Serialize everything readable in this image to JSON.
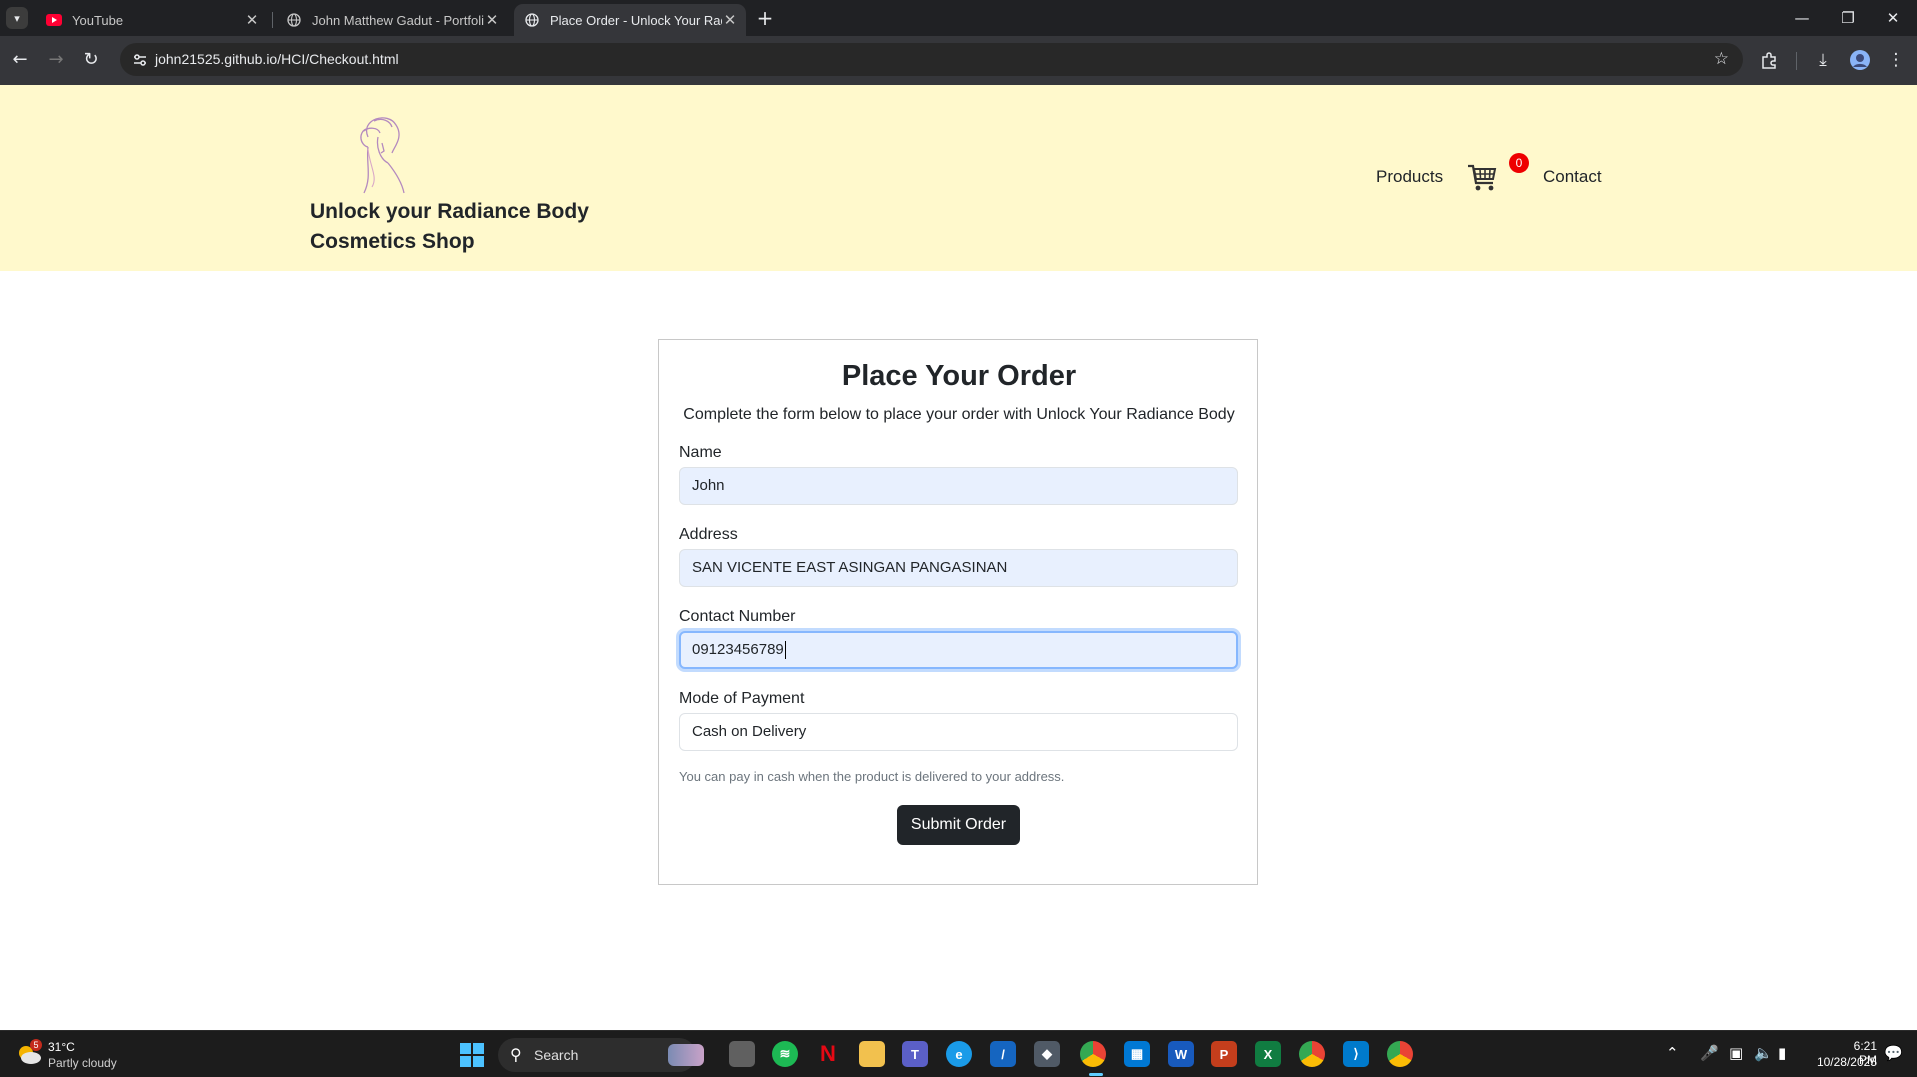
{
  "browser": {
    "tabs": [
      {
        "title": "YouTube",
        "icon": "youtube-icon",
        "active": false
      },
      {
        "title": "John Matthew Gadut - Portfolio",
        "icon": "globe-icon",
        "active": false
      },
      {
        "title": "Place Order - Unlock Your Radiance",
        "icon": "globe-icon",
        "active": true
      }
    ],
    "url": "john21525.github.io/HCI/Checkout.html"
  },
  "header": {
    "brand": "Unlock your Radiance Body Cosmetics Shop",
    "nav": {
      "products": "Products",
      "contact": "Contact"
    },
    "cart_count": "0"
  },
  "form": {
    "title": "Place Your Order",
    "subtitle": "Complete the form below to place your order with Unlock Your Radiance Body",
    "name_label": "Name",
    "name_value": "John",
    "address_label": "Address",
    "address_value": "SAN VICENTE EAST ASINGAN PANGASINAN",
    "contact_label": "Contact Number",
    "contact_value": "09123456789",
    "payment_label": "Mode of Payment",
    "payment_value": "Cash on Delivery",
    "payment_note": "You can pay in cash when the product is delivered to your address.",
    "submit_label": "Submit Order"
  },
  "taskbar": {
    "weather_temp": "31°C",
    "weather_desc": "Partly cloudy",
    "weather_badge": "5",
    "search_label": "Search",
    "time": "6:21 PM",
    "date": "10/28/2025"
  },
  "colors": {
    "header_bg": "#fff9cc",
    "badge": "#e00000",
    "button": "#212529"
  }
}
